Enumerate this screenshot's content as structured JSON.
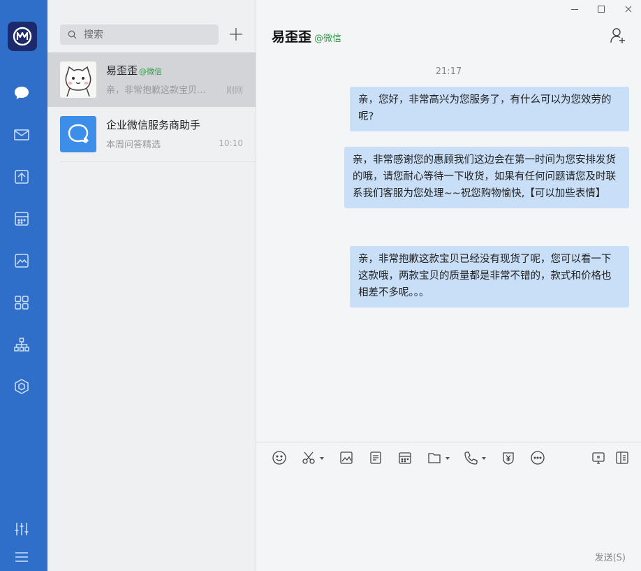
{
  "window": {
    "min_icon": "minimize-icon",
    "max_icon": "maximize-icon",
    "close_icon": "close-icon"
  },
  "rail": {
    "logo": "app-logo",
    "items": [
      "chat-icon",
      "mail-icon",
      "document-icon",
      "calendar-icon",
      "image-icon",
      "apps-grid-icon",
      "org-chart-icon",
      "cube-icon"
    ],
    "bottom": [
      "settings-sliders-icon",
      "menu-icon"
    ],
    "colors": {
      "rail_bg": "#2f6ec9",
      "logo_bg": "#1c2a6b"
    }
  },
  "list": {
    "search": {
      "placeholder": "搜索"
    },
    "add_icon": "plus-icon",
    "conversations": [
      {
        "name": "易歪歪",
        "source": "@微信",
        "preview": "亲，非常抱歉这款宝贝已经没有现货了呢，您可以看一下这款哦",
        "time": "刚刚",
        "active": true
      },
      {
        "name": "企业微信服务商助手",
        "source": "",
        "preview": "本周问答精选",
        "time": "10:10",
        "active": false
      }
    ]
  },
  "chat": {
    "title": "易歪歪",
    "source": "@微信",
    "timestamp": "21:17",
    "messages": [
      "亲，您好，非常高兴为您服务了，有什么可以为您效劳的呢?",
      "亲，非常感谢您的惠顾我们这边会在第一时间为您安排发货的哦，请您耐心等待一下收货，如果有任何问题请您及时联系我们客服为您处理~~祝您购物愉快,【可以加些表情】",
      "亲，非常抱歉这款宝贝已经没有现货了呢，您可以看一下这款哦，两款宝贝的质量都是非常不错的，款式和价格也相差不多呢。。。"
    ],
    "toolbar": [
      "emoji-icon",
      "scissors-icon",
      "image-icon",
      "notes-icon",
      "calendar-icon",
      "folder-icon",
      "phone-icon",
      "payment-icon",
      "more-icon",
      "screen-share-icon",
      "sidebar-icon"
    ],
    "send_label": "发送(S)",
    "bubble_color": "#c8dff7"
  }
}
